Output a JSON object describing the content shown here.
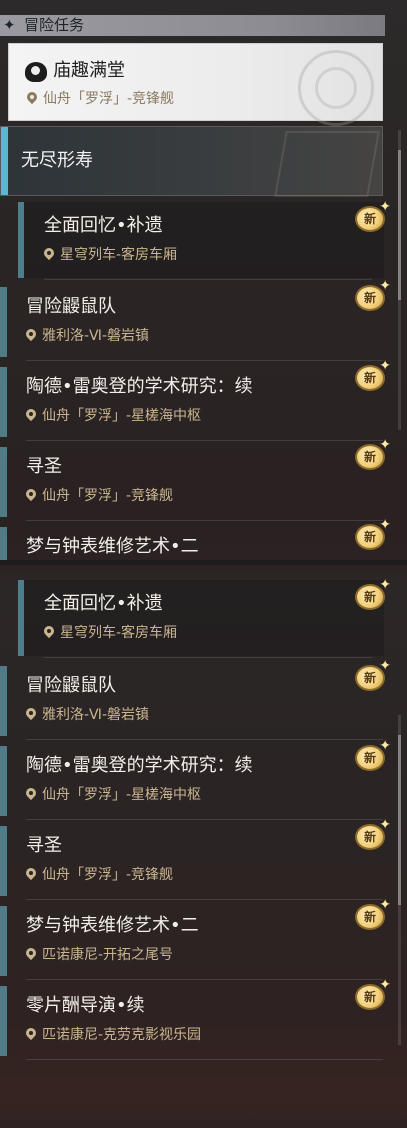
{
  "section": {
    "title": "冒险任务",
    "icon": "diamond-icon"
  },
  "active_quest": {
    "name": "庙趣满堂",
    "location": "仙舟「罗浮」-竞锋舰",
    "icon": "quest-type-icon"
  },
  "category": {
    "name": "无尽形寿"
  },
  "badge_label": "新",
  "top_list": [
    {
      "name": "全面回忆•补遗",
      "location": "星穹列车-客房车厢",
      "sub": true
    },
    {
      "name": "冒险鼹鼠队",
      "location": "雅利洛-Ⅵ-磐岩镇",
      "sub": false
    },
    {
      "name": "陶德•雷奥登的学术研究：续",
      "location": "仙舟「罗浮」-星槎海中枢",
      "sub": false
    },
    {
      "name": "寻圣",
      "location": "仙舟「罗浮」-竞锋舰",
      "sub": false
    },
    {
      "name": "梦与钟表维修艺术•二",
      "location": "",
      "sub": false
    }
  ],
  "bottom_list": [
    {
      "name": "全面回忆•补遗",
      "location": "星穹列车-客房车厢",
      "sub": true
    },
    {
      "name": "冒险鼹鼠队",
      "location": "雅利洛-Ⅵ-磐岩镇",
      "sub": false
    },
    {
      "name": "陶德•雷奥登的学术研究：续",
      "location": "仙舟「罗浮」-星槎海中枢",
      "sub": false
    },
    {
      "name": "寻圣",
      "location": "仙舟「罗浮」-竞锋舰",
      "sub": false
    },
    {
      "name": "梦与钟表维修艺术•二",
      "location": "匹诺康尼-开拓之尾号",
      "sub": false
    },
    {
      "name": "零片酬导演•续",
      "location": "匹诺康尼-克劳克影视乐园",
      "sub": false
    }
  ],
  "colors": {
    "accent": "#5ab7cf",
    "location": "#c9b58f",
    "badge": "#f2cf7a"
  }
}
